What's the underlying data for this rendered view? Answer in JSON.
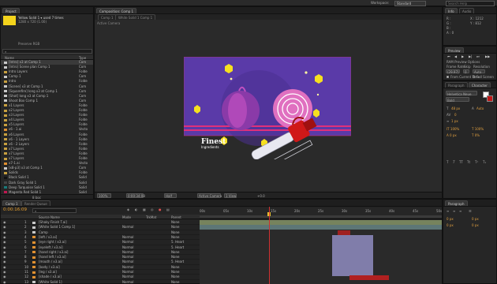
{
  "top": {
    "workspace_label": "Workspace:",
    "workspace_value": "Standard",
    "search_placeholder": "Search Help"
  },
  "project": {
    "tab": "Project",
    "selected_name": "Yellow Solid 1 ▾ used 7 times",
    "selected_info": "1280 x 720 (1.00)",
    "preview_label": "Preserve RGB",
    "search_placeholder": "",
    "col_name": "Name",
    "col_type": "Type",
    "items": [
      {
        "name": "[Intro] x3 at Comp 1",
        "type": "Com",
        "color": "#c9c9c9",
        "kind": "comp"
      },
      {
        "name": "[Intro] Scene plan Comp 1",
        "type": "Com",
        "color": "#c9c9c9",
        "kind": "comp"
      },
      {
        "name": "Intro Layers",
        "type": "Folde",
        "color": "#c8a040",
        "kind": "folder"
      },
      {
        "name": "Comp 1",
        "type": "Com",
        "color": "#c9c9c9",
        "kind": "comp"
      },
      {
        "name": "Intro",
        "type": "Folde",
        "color": "#c8a040",
        "kind": "folder"
      },
      {
        "name": "[Scene] x3 at Comp 1",
        "type": "Com",
        "color": "#c9c9c9",
        "kind": "comp"
      },
      {
        "name": "[Squarefire] long x3 at Comp 1",
        "type": "Com",
        "color": "#c9c9c9",
        "kind": "comp"
      },
      {
        "name": "[Shot] long x3 at Comp 1",
        "type": "Com",
        "color": "#c9c9c9",
        "kind": "comp"
      },
      {
        "name": "Shoot Box Comp 1",
        "type": "Com",
        "color": "#c9c9c9",
        "kind": "comp"
      },
      {
        "name": "x1 Layers",
        "type": "Folde",
        "color": "#c8a040",
        "kind": "folder"
      },
      {
        "name": "x2 Layers",
        "type": "Folde",
        "color": "#c8a040",
        "kind": "folder"
      },
      {
        "name": "x3 Layers",
        "type": "Folde",
        "color": "#c8a040",
        "kind": "folder"
      },
      {
        "name": "x4 Layers",
        "type": "Folde",
        "color": "#c8a040",
        "kind": "folder"
      },
      {
        "name": "x5 Layers",
        "type": "Folde",
        "color": "#c8a040",
        "kind": "folder"
      },
      {
        "name": "x6 - 1.ai",
        "type": "Vecto",
        "color": "#e09030",
        "kind": "file"
      },
      {
        "name": "x6 Layers",
        "type": "Folde",
        "color": "#c8a040",
        "kind": "folder"
      },
      {
        "name": "x6 - 1 Layers",
        "type": "Folde",
        "color": "#c8a040",
        "kind": "folder"
      },
      {
        "name": "x6 - 2 Layers",
        "type": "Folde",
        "color": "#c8a040",
        "kind": "folder"
      },
      {
        "name": "x7 Layers",
        "type": "Folde",
        "color": "#c8a040",
        "kind": "folder"
      },
      {
        "name": "x7 Layers",
        "type": "Folde",
        "color": "#c8a040",
        "kind": "folder"
      },
      {
        "name": "x7 Layers",
        "type": "Folde",
        "color": "#c8a040",
        "kind": "folder"
      },
      {
        "name": "x7-1.ai",
        "type": "Vecto",
        "color": "#e09030",
        "kind": "file"
      },
      {
        "name": "[x8-p3] x3 at Comp 1",
        "type": "Com",
        "color": "#c9c9c9",
        "kind": "comp"
      },
      {
        "name": "Solids",
        "type": "Folde",
        "color": "#c8a040",
        "kind": "folder"
      },
      {
        "name": "Black Solid 1",
        "type": "Solid",
        "color": "#111111",
        "kind": "solid"
      },
      {
        "name": "Dark Gray Solid 1",
        "type": "Solid",
        "color": "#444444",
        "kind": "solid"
      },
      {
        "name": "Deep Turquoise Solid 1",
        "type": "Solid",
        "color": "#1a7a7a",
        "kind": "solid"
      },
      {
        "name": "Magenta Red Solid 1",
        "type": "Solid",
        "color": "#c01850",
        "kind": "solid"
      }
    ],
    "bottom_label": "8 bpc"
  },
  "composition": {
    "tab": "Composition: Comp 1",
    "tabs": [
      "Comp 1",
      "White Solid 1 Comp 1"
    ],
    "camera_label": "Active Camera",
    "artwork_title": "Finest",
    "artwork_subtitle": "Ingredients",
    "footer": [
      "100%",
      "0:00:34:08",
      "Half",
      "Active Camera",
      "1 View",
      "+0.0"
    ]
  },
  "info": {
    "tab": "Info",
    "tab2": "Audio",
    "lines": [
      "R :",
      "G :",
      "B :",
      "A : 0",
      "X : 1212",
      "Y : 812"
    ]
  },
  "preview": {
    "tab": "Preview",
    "ram_label": "RAM Preview Options",
    "frame_rate_label": "Frame Rate",
    "skip_label": "Skip",
    "resolution_label": "Resolution",
    "frame_rate_value": "(29.97)",
    "skip_value": "0",
    "resolution_value": "Auto",
    "from_current": "From Current Time",
    "full_screen": "Full Screen"
  },
  "character": {
    "tab": "Character",
    "tab2": "Paragraph",
    "font_value": "Helvetica Neue",
    "style_value": "Bold",
    "size_value": "48 px",
    "leading_value": "Auto",
    "tracking_value": "0",
    "stroke_value": "1 px"
  },
  "paragraph": {
    "tab": "Paragraph"
  },
  "timeline": {
    "tab": "Comp 1",
    "tab2": "Render Queue",
    "timecode": "0:00:16:09",
    "search_placeholder": "",
    "col_source": "Source Name",
    "col_mode": "Mode",
    "col_trkmat": "TrkMat",
    "col_parent": "Parent",
    "ruler": [
      "00s",
      "05s",
      "10s",
      "15s",
      "20s",
      "25s",
      "30s",
      "35s",
      "40s",
      "45s",
      "50s"
    ],
    "layers": [
      {
        "num": "1",
        "name": "[Shaky Finish T.ai]",
        "color": "#c9c9c9",
        "mode": "",
        "parent": "None"
      },
      {
        "num": "2",
        "name": "[White Solid 1 Comp 1]",
        "color": "#c9c9c9",
        "mode": "Normal",
        "parent": "None"
      },
      {
        "num": "3",
        "name": "Camp",
        "color": "#c9c9c9",
        "mode": "",
        "parent": "None"
      },
      {
        "num": "4",
        "name": "[left / x3.ai]",
        "color": "#e09030",
        "mode": "Normal",
        "parent": "None"
      },
      {
        "num": "5",
        "name": "[eye right / x3.ai]",
        "color": "#e09030",
        "mode": "Normal",
        "parent": "5. Heart"
      },
      {
        "num": "6",
        "name": "[eyeleft / x3.ai]",
        "color": "#e09030",
        "mode": "Normal",
        "parent": "5. Heart"
      },
      {
        "num": "7",
        "name": "[hand right / x3.ai]",
        "color": "#e09030",
        "mode": "Normal",
        "parent": "None"
      },
      {
        "num": "8",
        "name": "[hand left / x3.ai]",
        "color": "#e09030",
        "mode": "Normal",
        "parent": "None"
      },
      {
        "num": "9",
        "name": "[mouth / x3.ai]",
        "color": "#e09030",
        "mode": "Normal",
        "parent": "5. Heart"
      },
      {
        "num": "10",
        "name": "[body / x3.ai]",
        "color": "#e09030",
        "mode": "Normal",
        "parent": "None"
      },
      {
        "num": "11",
        "name": "[leg / x3.ai]",
        "color": "#e09030",
        "mode": "Normal",
        "parent": "None"
      },
      {
        "num": "12",
        "name": "[shade / x3.ai]",
        "color": "#e09030",
        "mode": "Normal",
        "parent": "None"
      },
      {
        "num": "13",
        "name": "[White Solid 1]",
        "color": "#c9c9c9",
        "mode": "Normal",
        "parent": "None"
      }
    ],
    "toggle_label": "Toggle Switches / Modes"
  }
}
